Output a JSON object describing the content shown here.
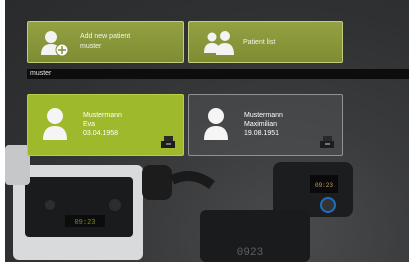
{
  "actions": {
    "add_patient_label": "Add new patient\nmuster",
    "add_patient_line1": "Add new patient",
    "add_patient_line2": "muster",
    "patient_list_label": "Patient list"
  },
  "search": {
    "value": "muster"
  },
  "patients": [
    {
      "last_name": "Mustermann",
      "first_name": "Eva",
      "birth_date": "03.04.1958",
      "selected": true
    },
    {
      "last_name": "Mustermann",
      "first_name": "Maximilian",
      "birth_date": "19.08.1951",
      "selected": false
    }
  ],
  "device_displays": [
    "09:23",
    "09:23",
    "0923"
  ],
  "colors": {
    "accent": "#9fb92d",
    "tile": "#8a9a3b",
    "search_bg": "#0d0d0d"
  }
}
